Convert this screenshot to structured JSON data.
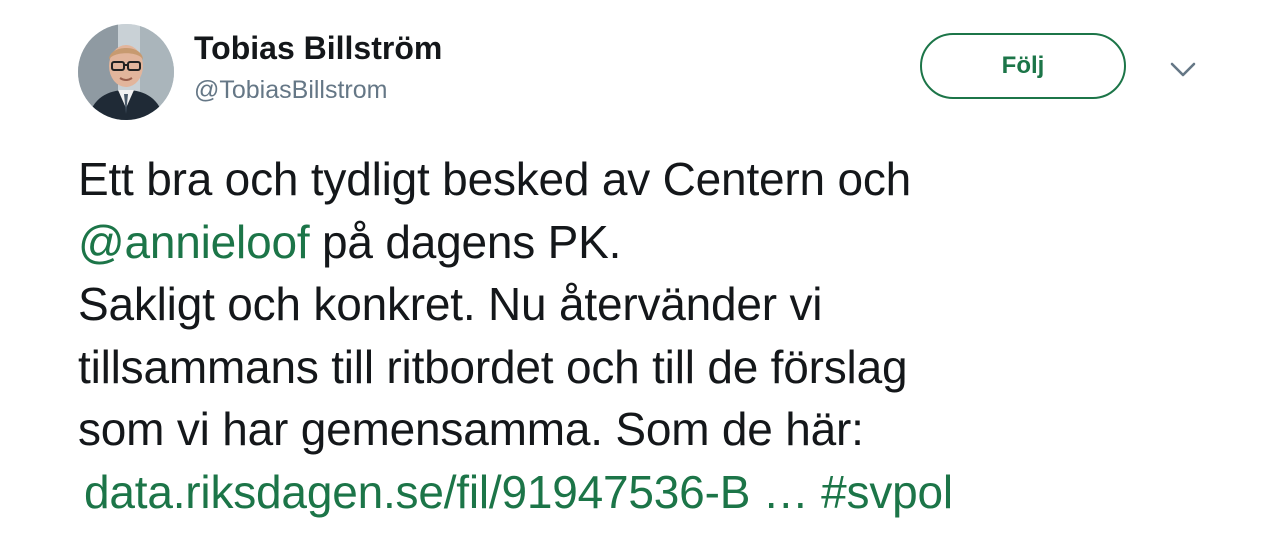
{
  "user": {
    "display_name": "Tobias Billström",
    "handle": "@TobiasBillstrom"
  },
  "actions": {
    "follow_label": "Följ",
    "menu_icon": "chevron-down-icon"
  },
  "tweet": {
    "line1": "Ett bra och tydligt besked av Centern och",
    "mention": "@annieloof",
    "line2_rest": " på dagens PK.",
    "line3": "Sakligt och konkret. Nu återvänder vi",
    "line4": "tillsammans till ritbordet och till de förslag",
    "line5": "som vi har gemensamma. Som de här:",
    "url": "data.riksdagen.se/fil/91947536-B …",
    "hashtag": "#svpol"
  },
  "colors": {
    "accent": "#1c7548",
    "text": "#14171a",
    "secondary": "#657786"
  }
}
